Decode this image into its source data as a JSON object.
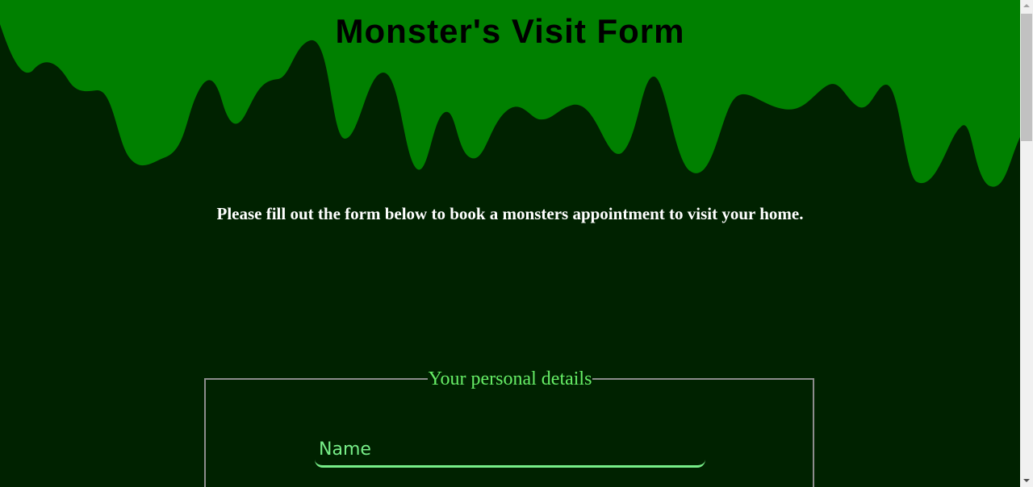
{
  "page": {
    "title": "Monster's Visit Form",
    "intro": "Please fill out the form below to book a monsters appointment to visit your home."
  },
  "form": {
    "fieldset_legend": "Your personal details",
    "name_field": {
      "placeholder": "Name",
      "value": ""
    }
  },
  "colors": {
    "background": "#002200",
    "slime": "#008000",
    "legend_text": "#66ee66",
    "input_accent": "#77ee88"
  },
  "icons": {
    "scroll_up": "triangle-up",
    "scroll_down": "triangle-down"
  }
}
